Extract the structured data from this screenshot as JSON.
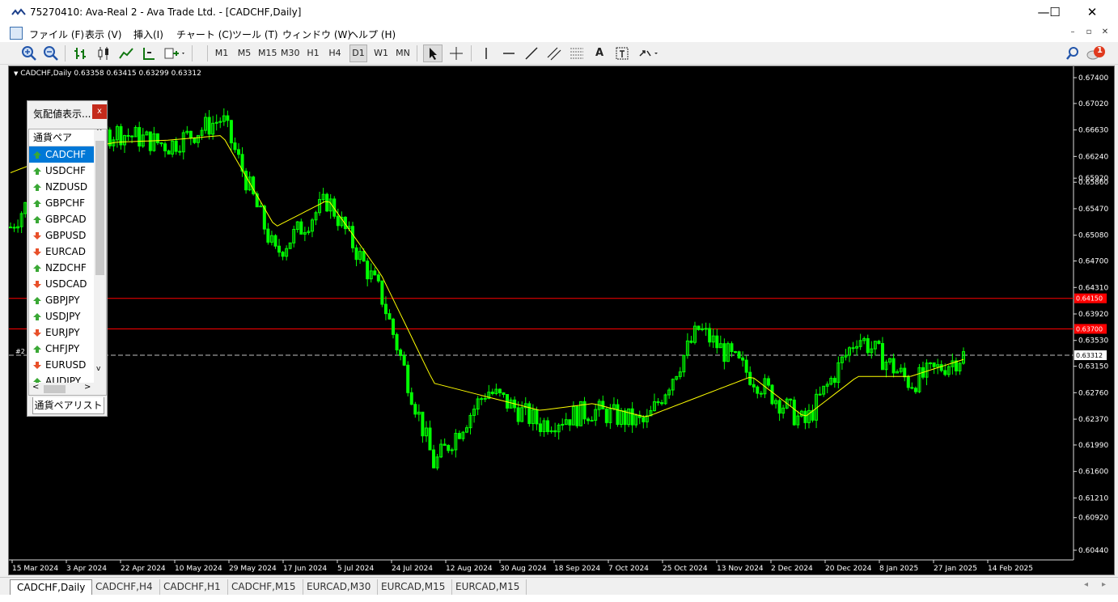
{
  "window": {
    "title": "75270410: Ava-Real 2 - Ava Trade Ltd. - [CADCHF,Daily]",
    "minimize_glyph": "—",
    "maximize_glyph": "☐",
    "close_glyph": "✕"
  },
  "menu": {
    "items": [
      "ファイル (F)",
      "表示 (V)",
      "挿入(I)",
      "チャート (C)",
      "ツール (T)",
      "ウィンドウ (W)",
      "ヘルプ (H)"
    ],
    "mdi_min": "–",
    "mdi_restore": "▫",
    "mdi_close": "✕"
  },
  "toolbar": {
    "timeframes": [
      "M1",
      "M5",
      "M15",
      "M30",
      "H1",
      "H4",
      "D1",
      "W1",
      "MN"
    ],
    "selected_timeframe": "D1",
    "tool_text": "A",
    "notification_count": "1"
  },
  "chart": {
    "symbol_info": "CADCHF,Daily  0.63358 0.63415 0.63299 0.63312",
    "price_labels": [
      "0.67400",
      "0.67020",
      "0.66630",
      "0.66240",
      "0.65920",
      "0.65860",
      "0.65470",
      "0.65080",
      "0.64700",
      "0.64310",
      "0.63920",
      "0.63530",
      "0.63150",
      "0.62760",
      "0.62370",
      "0.61990",
      "0.61600",
      "0.61210",
      "0.60920",
      "0.60440"
    ],
    "date_labels": [
      "15 Mar 2024",
      "3 Apr 2024",
      "22 Apr 2024",
      "10 May 2024",
      "29 May 2024",
      "17 Jun 2024",
      "5 Jul 2024",
      "24 Jul 2024",
      "12 Aug 2024",
      "30 Aug 2024",
      "18 Sep 2024",
      "7 Oct 2024",
      "25 Oct 2024",
      "13 Nov 2024",
      "2 Dec 2024",
      "20 Dec 2024",
      "8 Jan 2025",
      "27 Jan 2025",
      "14 Feb 2025"
    ],
    "hline_labels": [
      "0.64150",
      "0.63700"
    ],
    "current_price_label": "0.63312",
    "order_label": "#2",
    "colors": {
      "background": "#000000",
      "candles": "#00ff00",
      "ma": "#ffff00",
      "hline": "#ff0000",
      "bid": "#c0c0c0"
    }
  },
  "chart_data": {
    "type": "candlestick",
    "symbol": "CADCHF",
    "timeframe": "Daily",
    "ylim": [
      0.6044,
      0.674
    ],
    "horizontal_lines": [
      0.6415,
      0.637
    ],
    "last_price": 0.63312,
    "close_path": [
      [
        "15 Mar 2024",
        0.652
      ],
      [
        "3 Apr 2024",
        0.663
      ],
      [
        "22 Apr 2024",
        0.666
      ],
      [
        "10 May 2024",
        0.664
      ],
      [
        "29 May 2024",
        0.668
      ],
      [
        "17 Jun 2024",
        0.648
      ],
      [
        "5 Jul 2024",
        0.656
      ],
      [
        "24 Jul 2024",
        0.642
      ],
      [
        "12 Aug 2024",
        0.617
      ],
      [
        "30 Aug 2024",
        0.628
      ],
      [
        "18 Sep 2024",
        0.623
      ],
      [
        "7 Oct 2024",
        0.625
      ],
      [
        "25 Oct 2024",
        0.623
      ],
      [
        "13 Nov 2024",
        0.637
      ],
      [
        "2 Dec 2024",
        0.63
      ],
      [
        "20 Dec 2024",
        0.623
      ],
      [
        "8 Jan 2025",
        0.636
      ],
      [
        "27 Jan 2025",
        0.629
      ],
      [
        "14 Feb 2025",
        0.6331
      ]
    ],
    "ma_path": [
      [
        "15 Mar 2024",
        0.66
      ],
      [
        "3 Apr 2024",
        0.663
      ],
      [
        "22 Apr 2024",
        0.6645
      ],
      [
        "10 May 2024",
        0.6648
      ],
      [
        "29 May 2024",
        0.6655
      ],
      [
        "17 Jun 2024",
        0.652
      ],
      [
        "5 Jul 2024",
        0.656
      ],
      [
        "24 Jul 2024",
        0.645
      ],
      [
        "12 Aug 2024",
        0.629
      ],
      [
        "30 Aug 2024",
        0.627
      ],
      [
        "18 Sep 2024",
        0.625
      ],
      [
        "7 Oct 2024",
        0.626
      ],
      [
        "25 Oct 2024",
        0.624
      ],
      [
        "13 Nov 2024",
        0.627
      ],
      [
        "2 Dec 2024",
        0.63
      ],
      [
        "20 Dec 2024",
        0.624
      ],
      [
        "8 Jan 2025",
        0.63
      ],
      [
        "27 Jan 2025",
        0.63
      ],
      [
        "14 Feb 2025",
        0.6325
      ]
    ]
  },
  "market_watch": {
    "title": "気配値表示...",
    "close_label": "x",
    "column_header": "通貨ペア",
    "tab_label": "通貨ペアリスト",
    "scroll_left": "<",
    "scroll_right": ">",
    "scroll_up": "^",
    "scroll_down": "v",
    "rows": [
      {
        "symbol": "CADCHF",
        "dir": "up"
      },
      {
        "symbol": "USDCHF",
        "dir": "up"
      },
      {
        "symbol": "NZDUSD",
        "dir": "up"
      },
      {
        "symbol": "GBPCHF",
        "dir": "up"
      },
      {
        "symbol": "GBPCAD",
        "dir": "up"
      },
      {
        "symbol": "GBPUSD",
        "dir": "down"
      },
      {
        "symbol": "EURCAD",
        "dir": "down"
      },
      {
        "symbol": "NZDCHF",
        "dir": "up"
      },
      {
        "symbol": "USDCAD",
        "dir": "down"
      },
      {
        "symbol": "GBPJPY",
        "dir": "up"
      },
      {
        "symbol": "USDJPY",
        "dir": "up"
      },
      {
        "symbol": "EURJPY",
        "dir": "down"
      },
      {
        "symbol": "CHFJPY",
        "dir": "up"
      },
      {
        "symbol": "EURUSD",
        "dir": "down"
      },
      {
        "symbol": "AUDJPY",
        "dir": "up"
      }
    ],
    "colors": {
      "up": "#3aa835",
      "down": "#e8502a",
      "selected": "#0078d7"
    }
  },
  "chart_tabs": [
    "CADCHF,Daily",
    "CADCHF,H4",
    "CADCHF,H1",
    "CADCHF,M15",
    "EURCAD,M30",
    "EURCAD,M15",
    "EURCAD,M15"
  ],
  "active_tab": "CADCHF,Daily"
}
